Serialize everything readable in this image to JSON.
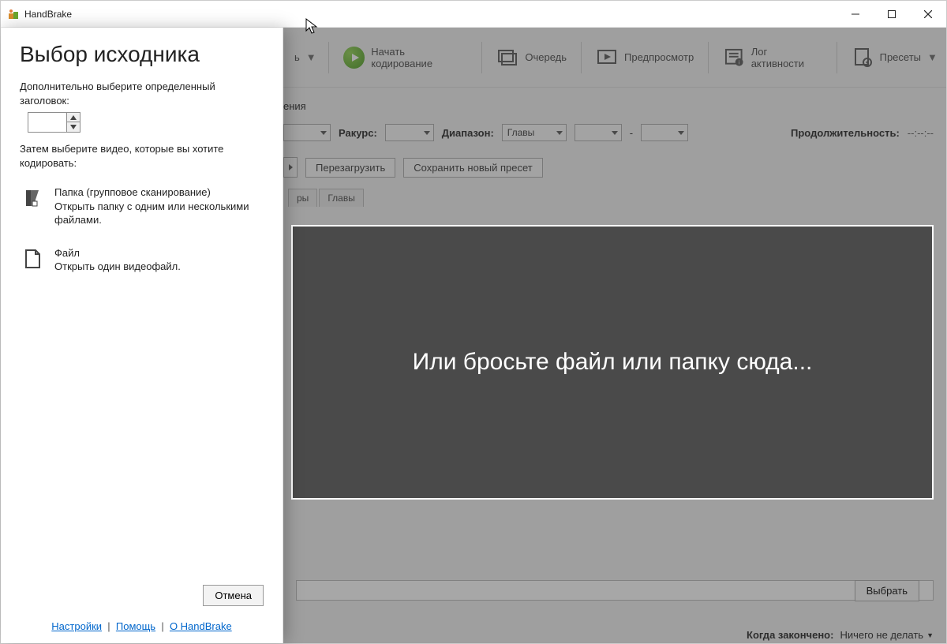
{
  "window": {
    "title": "HandBrake"
  },
  "panel": {
    "title": "Выбор исходника",
    "instruction1": "Дополнительно выберите определенный заголовок:",
    "instruction2": "Затем выберите видео, которые вы хотите кодировать:",
    "folder": {
      "title": "Папка (групповое сканирование)",
      "desc": "Открыть папку с одним или несколькими файлами."
    },
    "file": {
      "title": "Файл",
      "desc": "Открыть один видеофайл."
    },
    "cancel": "Отмена",
    "links": {
      "settings": "Настройки",
      "help": "Помощь",
      "about": "О HandBrake"
    }
  },
  "toolbar": {
    "open_suffix": "ь",
    "start": "Начать кодирование",
    "queue": "Очередь",
    "preview": "Предпросмотр",
    "activity": "Лог активности",
    "presets": "Пресеты"
  },
  "row": {
    "ения": "ения",
    "angle": "Ракурс:",
    "range": "Диапазон:",
    "chapters": "Главы",
    "dash": "-",
    "duration_label": "Продолжительность:",
    "duration_value": "--:--:--"
  },
  "preset": {
    "reload": "Перезагрузить",
    "save_new": "Сохранить новый пресет"
  },
  "tabs": {
    "t1": "ры",
    "t2": "Главы"
  },
  "dropzone": "Или бросьте файл или папку сюда...",
  "bottom": {
    "browse": "Выбрать",
    "done_label": "Когда закончено:",
    "done_value": "Ничего не делать"
  }
}
